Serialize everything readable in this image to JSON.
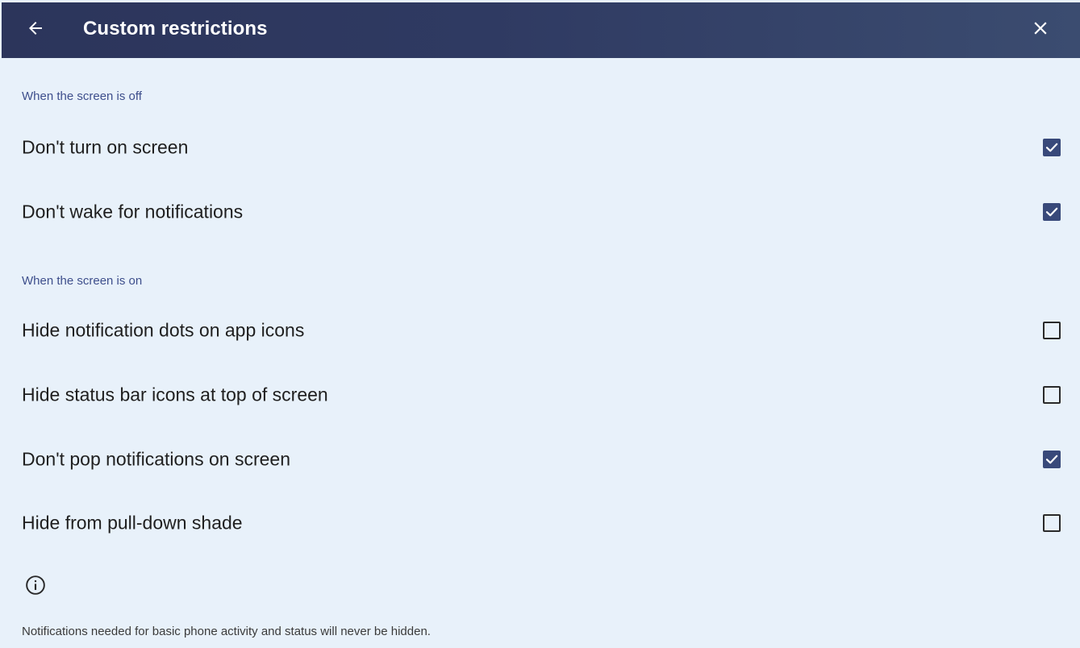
{
  "header": {
    "title": "Custom restrictions",
    "back_icon": "arrow-left-icon",
    "close_icon": "close-icon"
  },
  "sections": [
    {
      "header": "When the screen is off",
      "items": [
        {
          "label": "Don't turn on screen",
          "checked": true
        },
        {
          "label": "Don't wake for notifications",
          "checked": true
        }
      ]
    },
    {
      "header": "When the screen is on",
      "items": [
        {
          "label": "Hide notification dots on app icons",
          "checked": false
        },
        {
          "label": "Hide status bar icons at top of screen",
          "checked": false
        },
        {
          "label": "Don't pop notifications on screen",
          "checked": true
        },
        {
          "label": "Hide from pull-down shade",
          "checked": false
        }
      ]
    }
  ],
  "footer": {
    "info_icon": "info-icon",
    "note": "Notifications needed for basic phone activity and status will never be hidden."
  },
  "colors": {
    "app_bar": "#2f3a62",
    "background": "#e8f1fa",
    "accent": "#38497a",
    "section_header": "#3e4f8c"
  }
}
